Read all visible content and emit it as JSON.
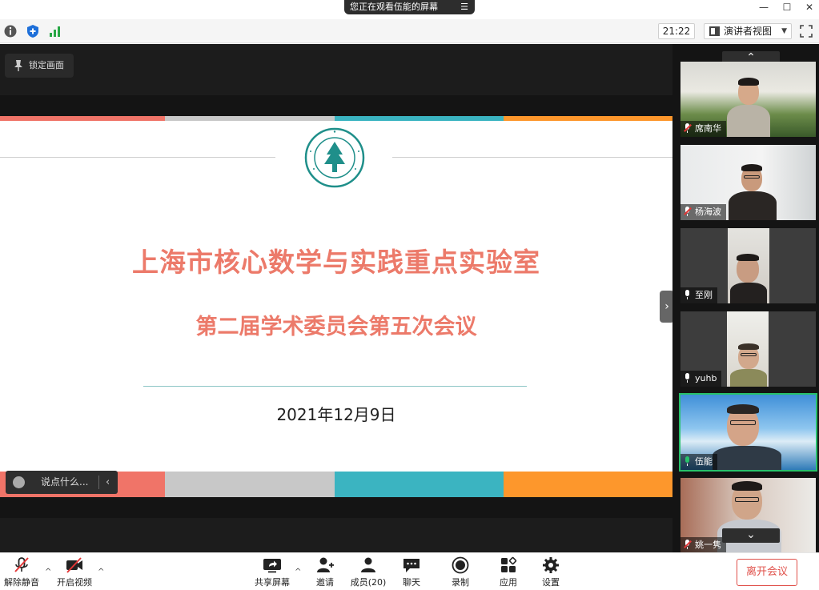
{
  "titlebar": {
    "share_notice": "您正在观看伍能的屏幕",
    "menu_glyph": "☰",
    "minimize": "—",
    "maximize": "☐",
    "close": "✕"
  },
  "toprow": {
    "clock": "21:22",
    "view_label": "演讲者视图",
    "view_caret": "▼"
  },
  "share": {
    "lock_label": "锁定画面",
    "chat_placeholder": "说点什么...",
    "chat_collapse": "‹",
    "panel_toggle": "›",
    "slide": {
      "title": "上海市核心数学与实践重点实验室",
      "subtitle": "第二届学术委员会第五次会议",
      "date": "2021年12月9日",
      "stripe_colors": [
        "#f07468",
        "#c8c8c8",
        "#3bb4c1",
        "#fd972c"
      ]
    }
  },
  "participants": {
    "scroll_up": "⌃",
    "scroll_down": "⌄",
    "list": [
      {
        "name": "席南华",
        "mic": "muted"
      },
      {
        "name": "杨海波",
        "mic": "muted"
      },
      {
        "name": "至刚",
        "mic": "on"
      },
      {
        "name": "yuhb",
        "mic": "on"
      },
      {
        "name": "伍能",
        "mic": "live"
      },
      {
        "name": "姚一隽",
        "mic": "muted"
      }
    ]
  },
  "toolbar": {
    "unmute": "解除静音",
    "start_video": "开启视频",
    "share_screen": "共享屏幕",
    "invite": "邀请",
    "members": "成员(20)",
    "chat": "聊天",
    "record": "录制",
    "apps": "应用",
    "settings": "设置",
    "leave": "离开会议",
    "caret": "^"
  },
  "colors": {
    "accent_title": "#ec7a6a",
    "active_speaker": "#27c16a",
    "leave": "#e0504a"
  }
}
